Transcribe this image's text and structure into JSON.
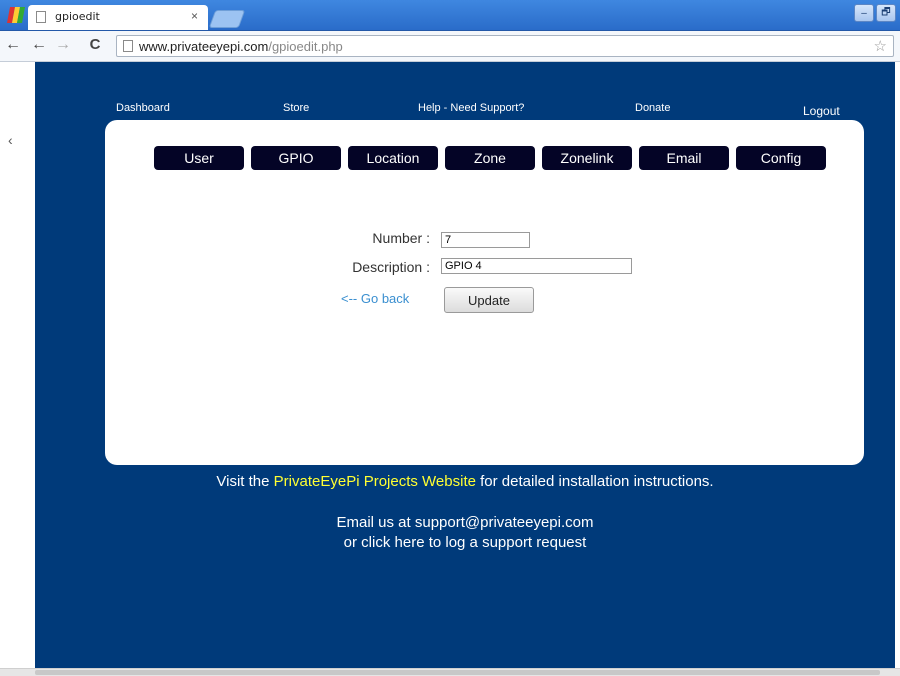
{
  "browser": {
    "tab_title": "gpioedit",
    "tab_close": "×",
    "url_domain": "www.privateeyepi.com",
    "url_path": "/gpioedit.php",
    "nav": {
      "back": "←",
      "forward": "→",
      "reload": "C",
      "prev": "←"
    },
    "star_icon": "☆",
    "window_buttons": {
      "minimize": "–",
      "maximize": "🗗"
    },
    "sidebar_toggle": "‹"
  },
  "site": {
    "top_nav": {
      "dashboard": "Dashboard",
      "store": "Store",
      "help": "Help - Need Support?",
      "donate": "Donate",
      "logout": "Logout"
    },
    "tabs": [
      "User",
      "GPIO",
      "Location",
      "Zone",
      "Zonelink",
      "Email",
      "Config"
    ],
    "form": {
      "number_label": "Number :",
      "number_value": "7",
      "description_label": "Description :",
      "description_value": "GPIO 4",
      "go_back": "<-- Go back",
      "update_button": "Update"
    },
    "footer": {
      "visit_prefix": "Visit the ",
      "visit_link": "PrivateEyePi Projects Website",
      "visit_suffix": " for detailed installation instructions.",
      "email_line": "Email us at support@privateeyepi.com",
      "support_line": "or click here to log a support request"
    }
  },
  "colors": {
    "site_background": "#003a7a",
    "tab_background": "#040426",
    "link_highlight": "#ffff33",
    "go_back_link": "#3a8fd0"
  }
}
